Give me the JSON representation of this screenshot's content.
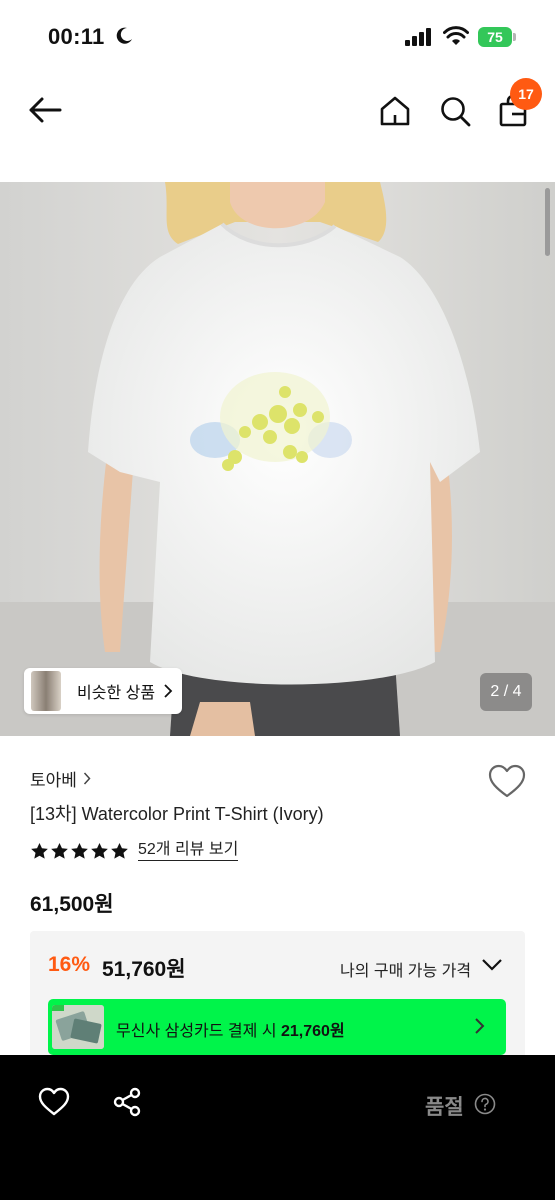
{
  "status_bar": {
    "time": "00:11",
    "battery": "75"
  },
  "nav": {
    "cart_count": "17"
  },
  "image": {
    "similar_products_label": "비슷한 상품",
    "counter": "2 / 4"
  },
  "product": {
    "brand": "토아베",
    "name": "[13차] Watercolor Print T-Shirt (Ivory)",
    "rating_stars": 5,
    "review_link": "52개 리뷰 보기",
    "original_price": "61,500원"
  },
  "pricing": {
    "discount_rate": "16%",
    "discount_price": "51,760원",
    "buyable_price_label": "나의 구매 가능 가격",
    "card_promo_prefix": "무신사 삼성카드 결제 시",
    "card_promo_price": "21,760원"
  },
  "bottom_bar": {
    "status_label": "품절"
  },
  "colors": {
    "accent_orange": "#ff5a12",
    "promo_green": "#00f44a",
    "bottom_bar_bg": "#000000"
  },
  "icons": [
    "moon-icon",
    "signal-icon",
    "wifi-icon",
    "back-arrow-icon",
    "home-icon",
    "search-icon",
    "shopping-bag-icon",
    "chevron-right-icon",
    "heart-icon",
    "star-icon",
    "chevron-down-icon",
    "share-icon",
    "help-icon"
  ]
}
